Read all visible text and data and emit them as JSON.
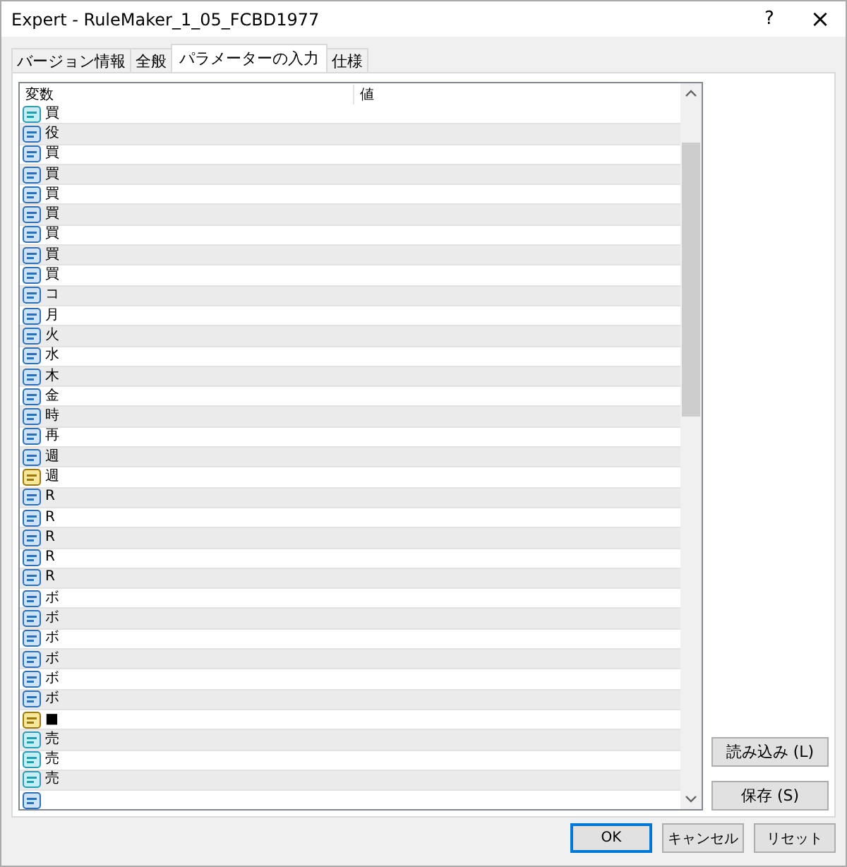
{
  "window": {
    "title": "Expert - RuleMaker_1_05_FCBD1977",
    "help": "?",
    "close": "×"
  },
  "tabs": [
    {
      "label": "バージョン情報",
      "selected": false
    },
    {
      "label": "全般",
      "selected": false
    },
    {
      "label": "パラメーターの入力",
      "selected": true
    },
    {
      "label": "仕様",
      "selected": false
    }
  ],
  "table": {
    "columns": [
      "変数",
      "値"
    ],
    "rows": [
      {
        "kind": "double",
        "name": "買"
      },
      {
        "kind": "int",
        "name": "役"
      },
      {
        "kind": "int",
        "name": "買"
      },
      {
        "kind": "int",
        "name": "買"
      },
      {
        "kind": "int",
        "name": "買"
      },
      {
        "kind": "int",
        "name": "買"
      },
      {
        "kind": "int",
        "name": "買"
      },
      {
        "kind": "int",
        "name": "買"
      },
      {
        "kind": "int",
        "name": "買"
      },
      {
        "kind": "int",
        "name": "コ"
      },
      {
        "kind": "int",
        "name": "月"
      },
      {
        "kind": "int",
        "name": "火"
      },
      {
        "kind": "int",
        "name": "水"
      },
      {
        "kind": "int",
        "name": "木"
      },
      {
        "kind": "int",
        "name": "金"
      },
      {
        "kind": "int",
        "name": "時"
      },
      {
        "kind": "int",
        "name": "再"
      },
      {
        "kind": "int",
        "name": "週"
      },
      {
        "kind": "string",
        "name": "週"
      },
      {
        "kind": "int",
        "name": "R"
      },
      {
        "kind": "int",
        "name": "R"
      },
      {
        "kind": "int",
        "name": "R"
      },
      {
        "kind": "int",
        "name": "R"
      },
      {
        "kind": "int",
        "name": "R"
      },
      {
        "kind": "int",
        "name": "ボ"
      },
      {
        "kind": "int",
        "name": "ボ"
      },
      {
        "kind": "int",
        "name": "ボ"
      },
      {
        "kind": "int",
        "name": "ボ"
      },
      {
        "kind": "int",
        "name": "ボ"
      },
      {
        "kind": "int",
        "name": "ボ"
      },
      {
        "kind": "string",
        "name": "■"
      },
      {
        "kind": "double",
        "name": "売"
      },
      {
        "kind": "double",
        "name": "売"
      },
      {
        "kind": "double",
        "name": "売"
      },
      {
        "kind": "int"
      }
    ]
  },
  "side_buttons": [
    "読み込み (L)",
    "保存 (S)"
  ],
  "buttons": [
    {
      "label": "OK",
      "default": true
    },
    {
      "label": "キャンセル",
      "default": false
    },
    {
      "label": "リセット",
      "default": false
    }
  ]
}
